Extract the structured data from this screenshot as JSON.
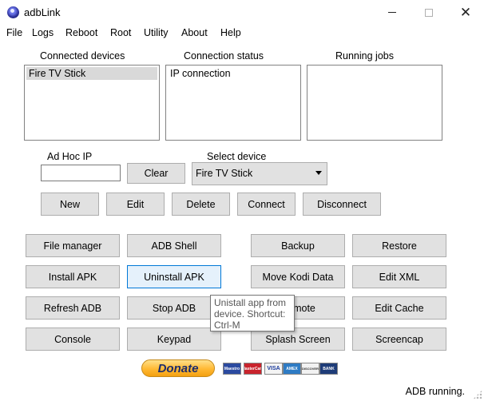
{
  "window": {
    "title": "adbLink"
  },
  "menu": [
    "File",
    "Logs",
    "Reboot",
    "Root",
    "Utility",
    "About",
    "Help"
  ],
  "panels": {
    "connected_devices": {
      "label": "Connected devices",
      "items": [
        "Fire TV Stick"
      ]
    },
    "connection_status": {
      "label": "Connection status",
      "items": [
        "IP connection"
      ]
    },
    "running_jobs": {
      "label": "Running jobs",
      "items": []
    }
  },
  "adhoc": {
    "label": "Ad Hoc IP",
    "value": "",
    "clear_label": "Clear"
  },
  "select_device": {
    "label": "Select device",
    "value": "Fire TV Stick"
  },
  "device_buttons": {
    "new": "New",
    "edit": "Edit",
    "delete": "Delete",
    "connect": "Connect",
    "disconnect": "Disconnect"
  },
  "actions": {
    "file_manager": "File manager",
    "adb_shell": "ADB Shell",
    "backup": "Backup",
    "restore": "Restore",
    "install_apk": "Install APK",
    "uninstall_apk": "Uninstall APK",
    "move_kodi_data": "Move Kodi Data",
    "edit_xml": "Edit XML",
    "refresh_adb": "Refresh ADB",
    "stop_adb": "Stop ADB",
    "remote": "Remote",
    "edit_cache": "Edit Cache",
    "console": "Console",
    "keypad": "Keypad",
    "splash_screen": "Splash Screen",
    "screencap": "Screencap"
  },
  "tooltip": {
    "text": "Unistall app from device. Shortcut: Ctrl-M"
  },
  "donate": {
    "label": "Donate"
  },
  "cards": [
    "Maestro",
    "MasterCard",
    "VISA",
    "AMEX",
    "DISCOVER",
    "BANK"
  ],
  "status": {
    "text": "ADB running."
  },
  "colors": {
    "button_face": "#e1e1e1",
    "focus_border": "#0078d7",
    "selection": "#d9d9d9"
  }
}
